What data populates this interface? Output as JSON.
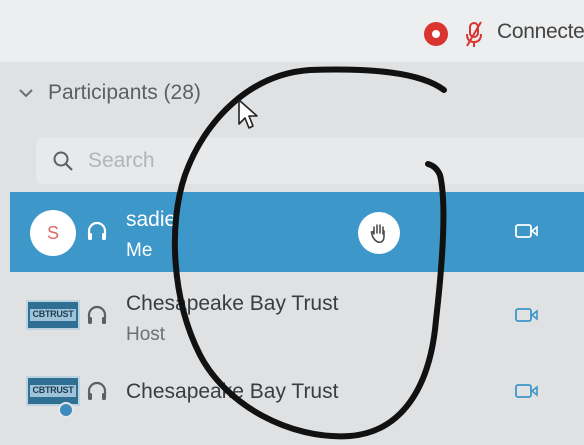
{
  "top_bar": {
    "status_text": "Connecte",
    "record_icon": "record-icon",
    "mic_icon": "mic-off-icon"
  },
  "participants_section": {
    "title": "Participants (28)",
    "chevron_icon": "chevron-down-icon"
  },
  "search": {
    "placeholder": "Search",
    "value": "",
    "icon": "search-icon"
  },
  "participants": [
    {
      "name": "sadie",
      "role": "Me",
      "avatar_letter": "S",
      "selected": true,
      "hand_raised": true
    },
    {
      "name": "Chesapeake Bay Trust",
      "role": "Host",
      "avatar_logo_text": "CBTRUST",
      "selected": false,
      "hand_raised": false
    },
    {
      "name": "Chesapeake Bay Trust",
      "role": "",
      "avatar_logo_text": "CBTRUST",
      "selected": false,
      "hand_raised": false
    }
  ],
  "colors": {
    "selected_row": "#3d97c9",
    "record": "#d9342f",
    "mic_off": "#d9342f",
    "annotation_ink": "#111111"
  }
}
